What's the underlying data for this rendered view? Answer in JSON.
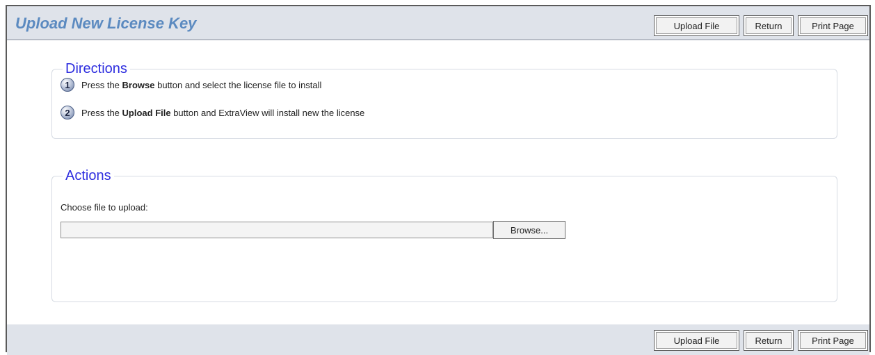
{
  "header": {
    "title": "Upload New License Key",
    "buttons": {
      "upload_file": "Upload File",
      "return": "Return",
      "print_page": "Print Page"
    }
  },
  "directions": {
    "legend": "Directions",
    "steps": [
      {
        "number": "1",
        "pre": "Press the ",
        "bold": "Browse",
        "post": " button and select the license file to install"
      },
      {
        "number": "2",
        "pre": "Press the ",
        "bold": "Upload File",
        "post": " button and ExtraView will install new the license"
      }
    ]
  },
  "actions": {
    "legend": "Actions",
    "choose_label": "Choose file to upload:",
    "file_value": "",
    "browse_label": "Browse..."
  },
  "footer": {
    "buttons": {
      "upload_file": "Upload File",
      "return": "Return",
      "print_page": "Print Page"
    }
  },
  "colors": {
    "title": "#5b8ac0",
    "legend": "#2d2ddf",
    "bar_background": "#dfe3ea"
  }
}
